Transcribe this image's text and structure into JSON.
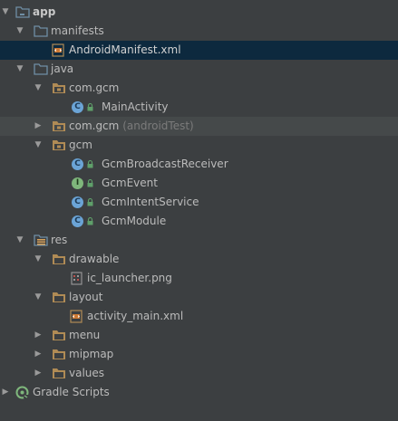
{
  "tree": {
    "app": "app",
    "manifests": "manifests",
    "android_manifest": "AndroidManifest.xml",
    "java": "java",
    "com_gcm_main": "com.gcm",
    "main_activity": "MainActivity",
    "com_gcm_test": "com.gcm",
    "com_gcm_test_suffix": "(androidTest)",
    "gcm": "gcm",
    "gcm_broadcast_receiver": "GcmBroadcastReceiver",
    "gcm_event": "GcmEvent",
    "gcm_intent_service": "GcmIntentService",
    "gcm_module": "GcmModule",
    "res": "res",
    "drawable": "drawable",
    "ic_launcher": "ic_launcher.png",
    "layout": "layout",
    "activity_main": "activity_main.xml",
    "menu": "menu",
    "mipmap": "mipmap",
    "values": "values",
    "gradle_scripts": "Gradle Scripts"
  },
  "badges": {
    "class_letter": "C",
    "interface_letter": "I"
  },
  "colors": {
    "background": "#3c3f41",
    "selected_row": "#0d293e",
    "highlighted_row": "#45494a",
    "folder": "#b08b55",
    "module_folder": "#6f8ea5",
    "class_badge": "#6ba4d6",
    "interface_badge": "#7fb77c",
    "lock": "#5fa06a"
  },
  "icons": {
    "expanded": "triangle-down",
    "collapsed": "triangle-right",
    "module_folder": "module-folder-icon",
    "folder": "folder-icon",
    "package": "package-icon",
    "res_folder": "res-folder-icon",
    "xml_file": "xml-file-icon",
    "image_file": "image-file-icon",
    "class": "class-icon",
    "interface": "interface-icon",
    "gradle": "gradle-icon"
  }
}
